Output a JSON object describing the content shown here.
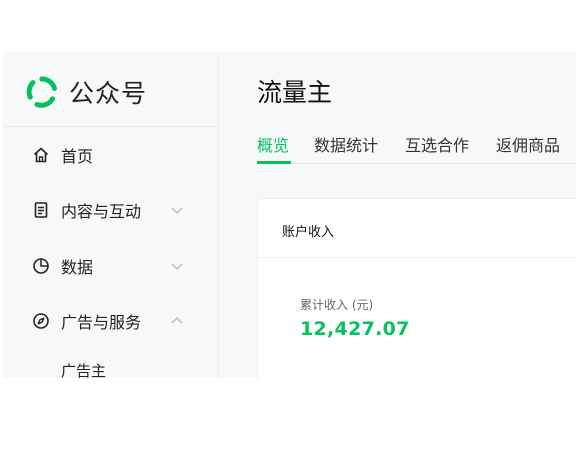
{
  "brand": {
    "name": "公众号",
    "color": "#07c160"
  },
  "sidebar": {
    "items": [
      {
        "label": "首页",
        "icon": "home-icon"
      },
      {
        "label": "内容与互动",
        "icon": "document-icon",
        "chevron": "chevron-down-icon"
      },
      {
        "label": "数据",
        "icon": "pie-chart-icon",
        "chevron": "chevron-down-icon"
      },
      {
        "label": "广告与服务",
        "icon": "compass-icon",
        "chevron": "chevron-up-icon"
      }
    ],
    "subitems": [
      {
        "label": "广告主"
      }
    ]
  },
  "main": {
    "title": "流量主",
    "tabs": [
      {
        "label": "概览",
        "active": true
      },
      {
        "label": "数据统计",
        "active": false
      },
      {
        "label": "互选合作",
        "active": false
      },
      {
        "label": "返佣商品",
        "active": false
      }
    ],
    "card": {
      "title": "账户收入",
      "stat_label": "累计收入 (元)",
      "stat_value": "12,427.07"
    }
  }
}
